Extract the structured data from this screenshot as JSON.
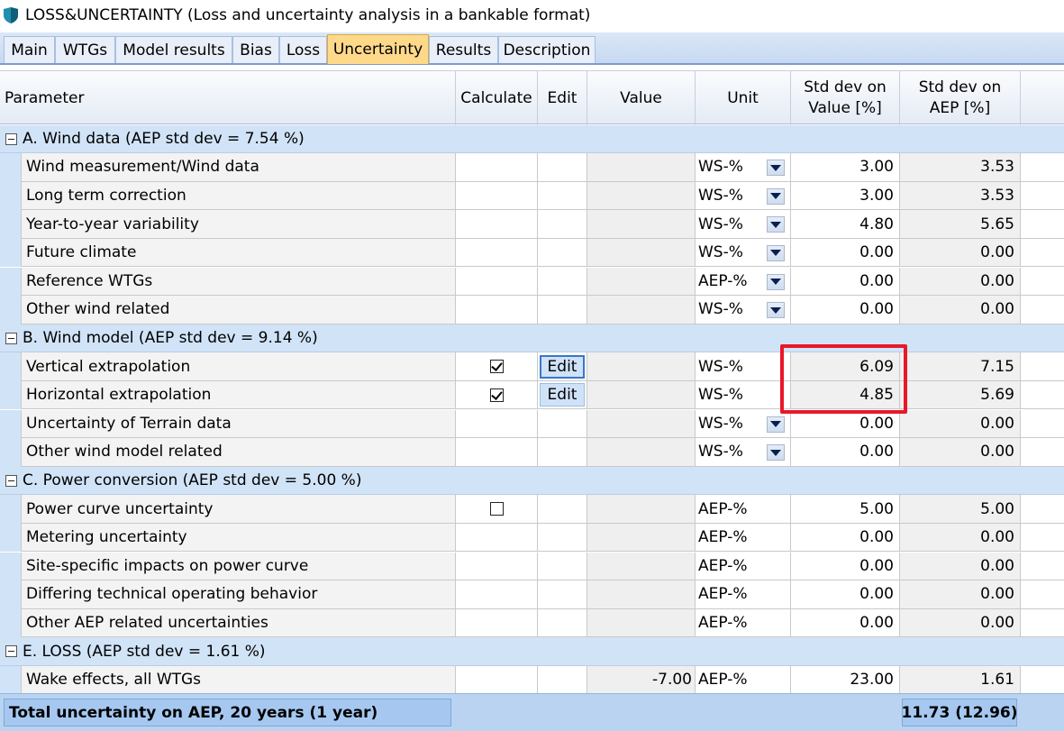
{
  "window": {
    "title": "LOSS&UNCERTAINTY (Loss and uncertainty analysis in a bankable format)",
    "icon": "app-shield-icon"
  },
  "tabs": [
    {
      "label": "Main",
      "active": false
    },
    {
      "label": "WTGs",
      "active": false
    },
    {
      "label": "Model results",
      "active": false
    },
    {
      "label": "Bias",
      "active": false
    },
    {
      "label": "Loss",
      "active": false
    },
    {
      "label": "Uncertainty",
      "active": true
    },
    {
      "label": "Results",
      "active": false
    },
    {
      "label": "Description",
      "active": false
    }
  ],
  "columns": {
    "parameter": "Parameter",
    "calculate": "Calculate",
    "edit": "Edit",
    "value": "Value",
    "unit": "Unit",
    "std_value_l1": "Std dev on",
    "std_value_l2": "Value [%]",
    "std_aep_l1": "Std dev on",
    "std_aep_l2": "AEP [%]"
  },
  "groups": [
    {
      "label": "A. Wind data (AEP std dev =  7.54 %)",
      "rows": [
        {
          "param": "Wind measurement/Wind data",
          "calc": null,
          "edit": null,
          "value": "",
          "unit": "WS-%",
          "dropdown": true,
          "sd_value": "3.00",
          "sd_aep": "3.53"
        },
        {
          "param": "Long term correction",
          "calc": null,
          "edit": null,
          "value": "",
          "unit": "WS-%",
          "dropdown": true,
          "sd_value": "3.00",
          "sd_aep": "3.53"
        },
        {
          "param": "Year-to-year variability",
          "calc": null,
          "edit": null,
          "value": "",
          "unit": "WS-%",
          "dropdown": true,
          "sd_value": "4.80",
          "sd_aep": "5.65"
        },
        {
          "param": "Future climate",
          "calc": null,
          "edit": null,
          "value": "",
          "unit": "WS-%",
          "dropdown": true,
          "sd_value": "0.00",
          "sd_aep": "0.00"
        },
        {
          "param": "Reference WTGs",
          "calc": null,
          "edit": null,
          "value": "",
          "unit": "AEP-%",
          "dropdown": true,
          "sd_value": "0.00",
          "sd_aep": "0.00"
        },
        {
          "param": "Other wind related",
          "calc": null,
          "edit": null,
          "value": "",
          "unit": "WS-%",
          "dropdown": true,
          "sd_value": "0.00",
          "sd_aep": "0.00"
        }
      ]
    },
    {
      "label": "B. Wind model (AEP std dev =  9.14 %)",
      "rows": [
        {
          "param": "Vertical extrapolation",
          "calc": true,
          "edit": "Edit",
          "edit_focused": true,
          "value": "",
          "unit": "WS-%",
          "dropdown": false,
          "sd_value": "6.09",
          "sd_value_readonly": true,
          "sd_aep": "7.15"
        },
        {
          "param": "Horizontal extrapolation",
          "calc": true,
          "edit": "Edit",
          "edit_focused": false,
          "value": "",
          "unit": "WS-%",
          "dropdown": false,
          "sd_value": "4.85",
          "sd_value_readonly": true,
          "sd_aep": "5.69"
        },
        {
          "param": "Uncertainty of Terrain data",
          "calc": null,
          "edit": null,
          "value": "",
          "unit": "WS-%",
          "dropdown": true,
          "sd_value": "0.00",
          "sd_aep": "0.00"
        },
        {
          "param": "Other wind model related",
          "calc": null,
          "edit": null,
          "value": "",
          "unit": "WS-%",
          "dropdown": true,
          "sd_value": "0.00",
          "sd_aep": "0.00"
        }
      ]
    },
    {
      "label": "C. Power conversion (AEP std dev =  5.00 %)",
      "rows": [
        {
          "param": "Power curve uncertainty",
          "calc": false,
          "edit": null,
          "value": "",
          "unit": "AEP-%",
          "dropdown": false,
          "sd_value": "5.00",
          "sd_aep": "5.00"
        },
        {
          "param": "Metering uncertainty",
          "calc": null,
          "edit": null,
          "value": "",
          "unit": "AEP-%",
          "dropdown": false,
          "sd_value": "0.00",
          "sd_aep": "0.00"
        },
        {
          "param": "Site-specific impacts on power curve",
          "calc": null,
          "edit": null,
          "value": "",
          "unit": "AEP-%",
          "dropdown": false,
          "sd_value": "0.00",
          "sd_aep": "0.00"
        },
        {
          "param": "Differing technical operating behavior",
          "calc": null,
          "edit": null,
          "value": "",
          "unit": "AEP-%",
          "dropdown": false,
          "sd_value": "0.00",
          "sd_aep": "0.00"
        },
        {
          "param": "Other AEP related uncertainties",
          "calc": null,
          "edit": null,
          "value": "",
          "unit": "AEP-%",
          "dropdown": false,
          "sd_value": "0.00",
          "sd_aep": "0.00"
        }
      ]
    },
    {
      "label": "E. LOSS (AEP std dev =  1.61 %)",
      "rows": [
        {
          "param": "Wake effects, all WTGs",
          "calc": null,
          "edit": null,
          "value": "-7.00",
          "unit": "AEP-%",
          "dropdown": false,
          "sd_value": "23.00",
          "sd_aep": "1.61"
        }
      ]
    }
  ],
  "footer": {
    "label": "Total uncertainty on AEP, 20 years (1 year)",
    "value": "11.73 (12.96)"
  },
  "colors": {
    "highlight": "#e8182a",
    "active_tab": "#ffd98a",
    "group_band": "#d1e3f7",
    "footer": "#b9d3f1"
  }
}
